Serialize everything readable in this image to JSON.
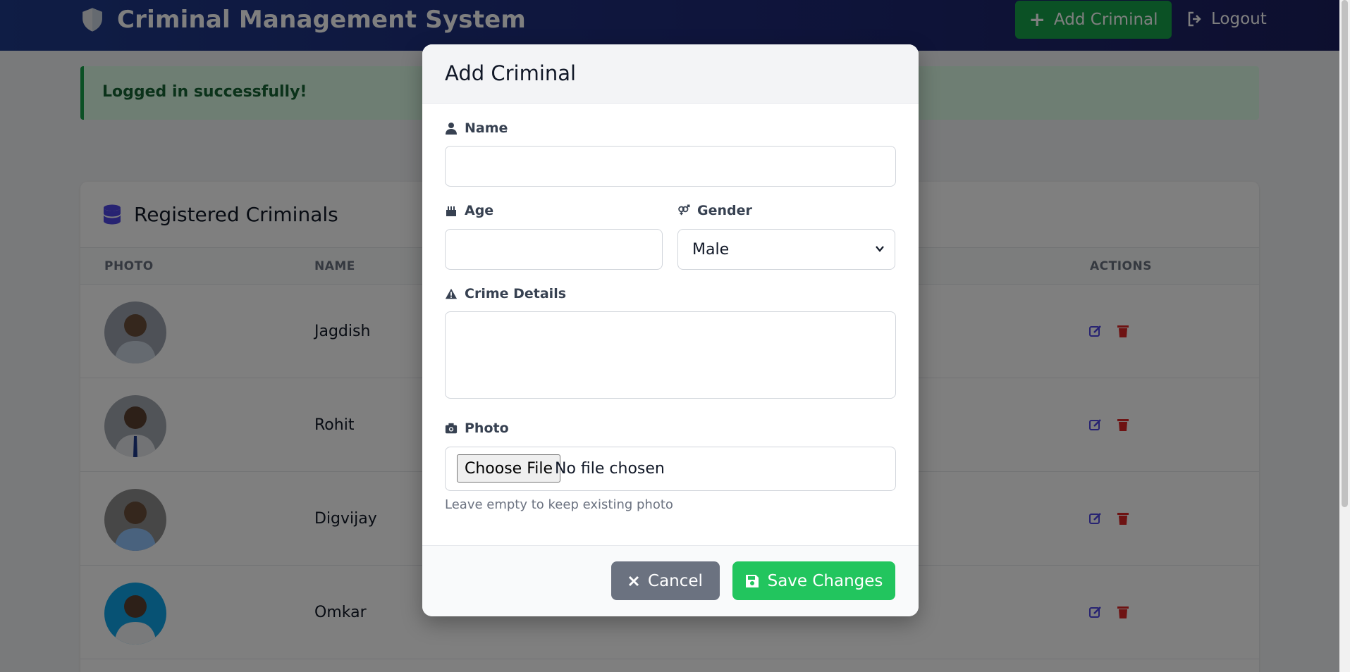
{
  "header": {
    "title": "Criminal Management System",
    "add_label": "Add Criminal",
    "logout_label": "Logout"
  },
  "alert": {
    "message": "Logged in successfully!"
  },
  "card": {
    "title": "Registered Criminals",
    "columns": [
      "PHOTO",
      "NAME",
      "ACTIONS"
    ],
    "rows": [
      {
        "name": "Jagdish"
      },
      {
        "name": "Rohit"
      },
      {
        "name": "Digvijay"
      },
      {
        "name": "Omkar"
      }
    ]
  },
  "modal": {
    "title": "Add Criminal",
    "name_label": "Name",
    "name_value": "",
    "age_label": "Age",
    "age_value": "",
    "gender_label": "Gender",
    "gender_value": "Male",
    "crime_label": "Crime Details",
    "crime_value": "",
    "photo_label": "Photo",
    "file_button": "Choose File",
    "file_status": "No file chosen",
    "photo_hint": "Leave empty to keep existing photo",
    "cancel_label": "Cancel",
    "save_label": "Save Changes"
  },
  "colors": {
    "header": "#1e2a78",
    "success": "#16a34a",
    "save": "#22c55e",
    "cancel": "#6b7280",
    "edit_icon": "#4f46e5",
    "delete_icon": "#dc2626"
  }
}
